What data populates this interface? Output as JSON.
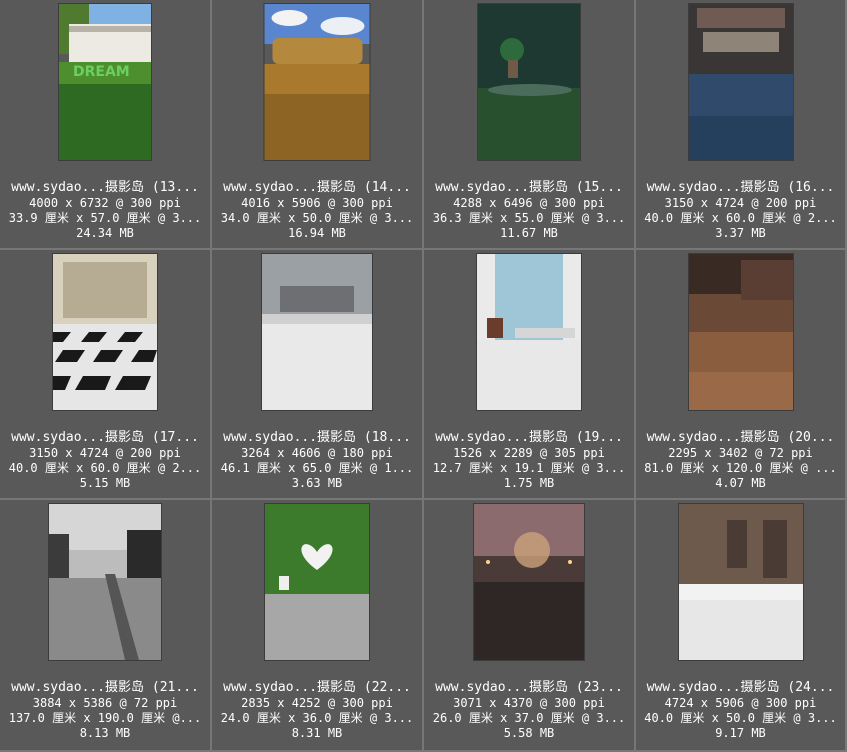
{
  "items": [
    {
      "name": "www.sydao...摄影岛 (13...",
      "dims": "4000 x 6732 @ 300 ppi",
      "physical": "33.9 厘米 x 57.0 厘米 @ 3...",
      "size": "24.34 MB",
      "thumb": "dream-grass"
    },
    {
      "name": "www.sydao...摄影岛 (14...",
      "dims": "4016 x 5906 @ 300 ppi",
      "physical": "34.0 厘米 x 50.0 厘米 @ 3...",
      "size": "16.94 MB",
      "thumb": "haystack-field"
    },
    {
      "name": "www.sydao...摄影岛 (15...",
      "dims": "4288 x 6496 @ 300 ppi",
      "physical": "36.3 厘米 x 55.0 厘米 @ 3...",
      "size": "11.67 MB",
      "thumb": "dark-garden"
    },
    {
      "name": "www.sydao...摄影岛 (16...",
      "dims": "3150 x 4724 @ 200 ppi",
      "physical": "40.0 厘米 x 60.0 厘米 @ 2...",
      "size": "3.37 MB",
      "thumb": "city-street-blue"
    },
    {
      "name": "www.sydao...摄影岛 (17...",
      "dims": "3150 x 4724 @ 200 ppi",
      "physical": "40.0 厘米 x 60.0 厘米 @ 2...",
      "size": "5.15 MB",
      "thumb": "checker-hall"
    },
    {
      "name": "www.sydao...摄影岛 (18...",
      "dims": "3264 x 4606 @ 180 ppi",
      "physical": "46.1 厘米 x 65.0 厘米 @ 1...",
      "size": "3.63 MB",
      "thumb": "castle-snow"
    },
    {
      "name": "www.sydao...摄影岛 (19...",
      "dims": "1526 x 2289 @ 305 ppi",
      "physical": "12.7 厘米 x 19.1 厘米 @ 3...",
      "size": "1.75 MB",
      "thumb": "white-curtain-sea"
    },
    {
      "name": "www.sydao...摄影岛 (20...",
      "dims": "2295 x 3402 @ 72 ppi",
      "physical": "81.0 厘米 x 120.0 厘米 @ ...",
      "size": "4.07 MB",
      "thumb": "tram-sunset"
    },
    {
      "name": "www.sydao...摄影岛 (21...",
      "dims": "3884 x 5386 @ 72 ppi",
      "physical": "137.0 厘米 x 190.0 厘米 @...",
      "size": "8.13 MB",
      "thumb": "bw-tram-street"
    },
    {
      "name": "www.sydao...摄影岛 (22...",
      "dims": "2835 x 4252 @ 300 ppi",
      "physical": "24.0 厘米 x 36.0 厘米 @ 3...",
      "size": "8.31 MB",
      "thumb": "ivy-heart-wall"
    },
    {
      "name": "www.sydao...摄影岛 (23...",
      "dims": "3071 x 4370 @ 300 ppi",
      "physical": "26.0 厘米 x 37.0 厘米 @ 3...",
      "size": "5.58 MB",
      "thumb": "fountain-night"
    },
    {
      "name": "www.sydao...摄影岛 (24...",
      "dims": "4724 x 5906 @ 300 ppi",
      "physical": "40.0 厘米 x 50.0 厘米 @ 3...",
      "size": "9.17 MB",
      "thumb": "snow-street-shop"
    }
  ]
}
